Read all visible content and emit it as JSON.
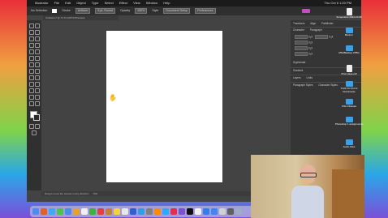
{
  "menubar": {
    "app": "Illustrator",
    "items": [
      "File",
      "Edit",
      "Object",
      "Type",
      "Select",
      "Effect",
      "View",
      "Window",
      "Help"
    ],
    "clock": "Thu Oct 6 1:20 PM"
  },
  "window": {
    "title": "Adobe Illustrator 2022",
    "control_bar": {
      "selection_label": "No Selection",
      "stroke_label": "Stroke",
      "brush": "Uniform",
      "stroke_weight": "5 pt. Round",
      "opacity_label": "Opacity",
      "opacity_value": "100%",
      "style_label": "Style",
      "doc_setup": "Document Setup",
      "preferences": "Preferences"
    },
    "doc_tab": "Untitled-1* @ 74 % (CMYK/Preview)",
    "status": {
      "zoom": "74%",
      "hint": "Drag to move the canvas in any direction"
    }
  },
  "panel": {
    "tabs": [
      "Transform",
      "Align",
      "Pathfinder"
    ],
    "sub_tabs": [
      "Character",
      "Paragraph"
    ],
    "label_hyphenate": "Hyphenate",
    "section_gradient": "Gradient",
    "section_layers": "Layers",
    "section_links": "Links",
    "paragraph_styles": "Paragraph Styles",
    "char_styles": "Character Styles",
    "fields": [
      "0 pt",
      "0 pt",
      "0 pt",
      "0 pt",
      "0 pt"
    ]
  },
  "desktop_icons": [
    {
      "label": "Screenshot 2022-10-06",
      "kind": "doc"
    },
    {
      "label": "Banner",
      "kind": "folder"
    },
    {
      "label": "MSUBackup 2TBG",
      "kind": "folder"
    },
    {
      "label": "Pixel page.pdf",
      "kind": "doc"
    },
    {
      "label": "T124 CC Prof 2 Documents",
      "kind": "folder"
    },
    {
      "label": "OSU Classes",
      "kind": "folder"
    },
    {
      "label": "Photoshop 1 assignments",
      "kind": "folder"
    },
    {
      "label": "Audio Files",
      "kind": "folder"
    }
  ],
  "colors": {
    "menubar_bg": "#1b1b1b",
    "window_bg": "#434343",
    "artboard": "#ffffff",
    "accent": "#c24dc2"
  }
}
